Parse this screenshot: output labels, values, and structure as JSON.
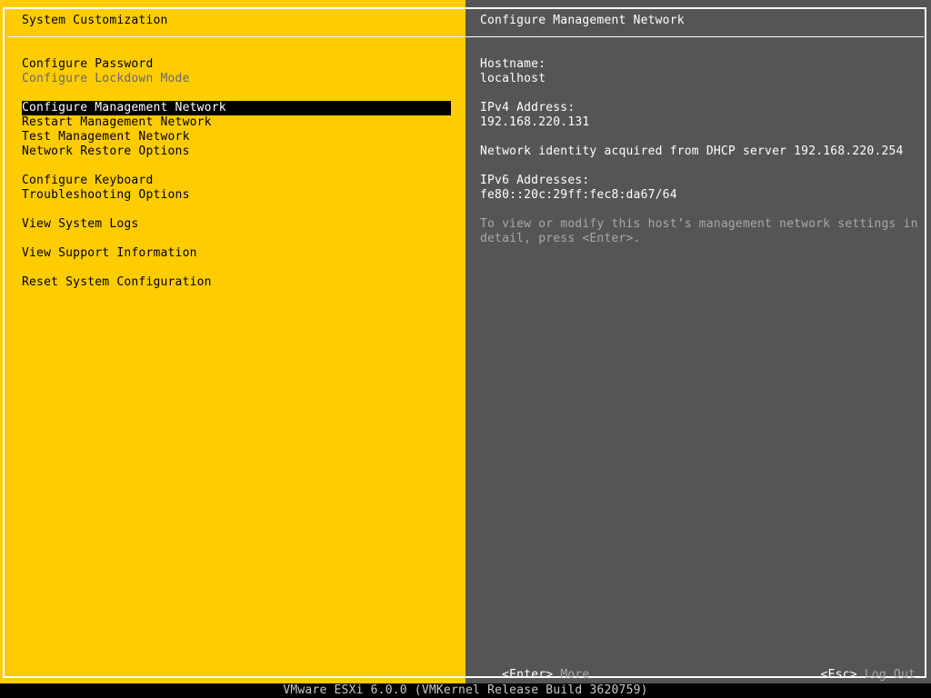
{
  "colors": {
    "left_panel": "#ffcc00",
    "right_panel": "#555555",
    "border": "#ffffff",
    "selected_bg": "#000000",
    "disabled_text": "#6a6a6a",
    "hint_text": "#a8a8a8"
  },
  "left_panel": {
    "title": "System Customization",
    "menu_groups": [
      [
        {
          "label": "Configure Password",
          "state": "normal"
        },
        {
          "label": "Configure Lockdown Mode",
          "state": "disabled"
        }
      ],
      [
        {
          "label": "Configure Management Network",
          "state": "selected"
        },
        {
          "label": "Restart Management Network",
          "state": "normal"
        },
        {
          "label": "Test Management Network",
          "state": "normal"
        },
        {
          "label": "Network Restore Options",
          "state": "normal"
        }
      ],
      [
        {
          "label": "Configure Keyboard",
          "state": "normal"
        },
        {
          "label": "Troubleshooting Options",
          "state": "normal"
        }
      ],
      [
        {
          "label": "View System Logs",
          "state": "normal"
        }
      ],
      [
        {
          "label": "View Support Information",
          "state": "normal"
        }
      ],
      [
        {
          "label": "Reset System Configuration",
          "state": "normal"
        }
      ]
    ]
  },
  "right_panel": {
    "title": "Configure Management Network",
    "hostname_label": "Hostname:",
    "hostname_value": "localhost",
    "ipv4_label": "IPv4 Address:",
    "ipv4_value": "192.168.220.131",
    "dhcp_note": "Network identity acquired from DHCP server 192.168.220.254",
    "ipv6_label": "IPv6 Addresses:",
    "ipv6_value": "fe80::20c:29ff:fec8:da67/64",
    "hint_line1": "To view or modify this host’s management network settings in",
    "hint_line2": "detail, press <Enter>."
  },
  "footer": {
    "enter_key": "<Enter>",
    "enter_action": "More",
    "esc_key": "<Esc>",
    "esc_action": "Log Out"
  },
  "status_bar": {
    "text": "VMware ESXi 6.0.0 (VMKernel Release Build 3620759)"
  }
}
